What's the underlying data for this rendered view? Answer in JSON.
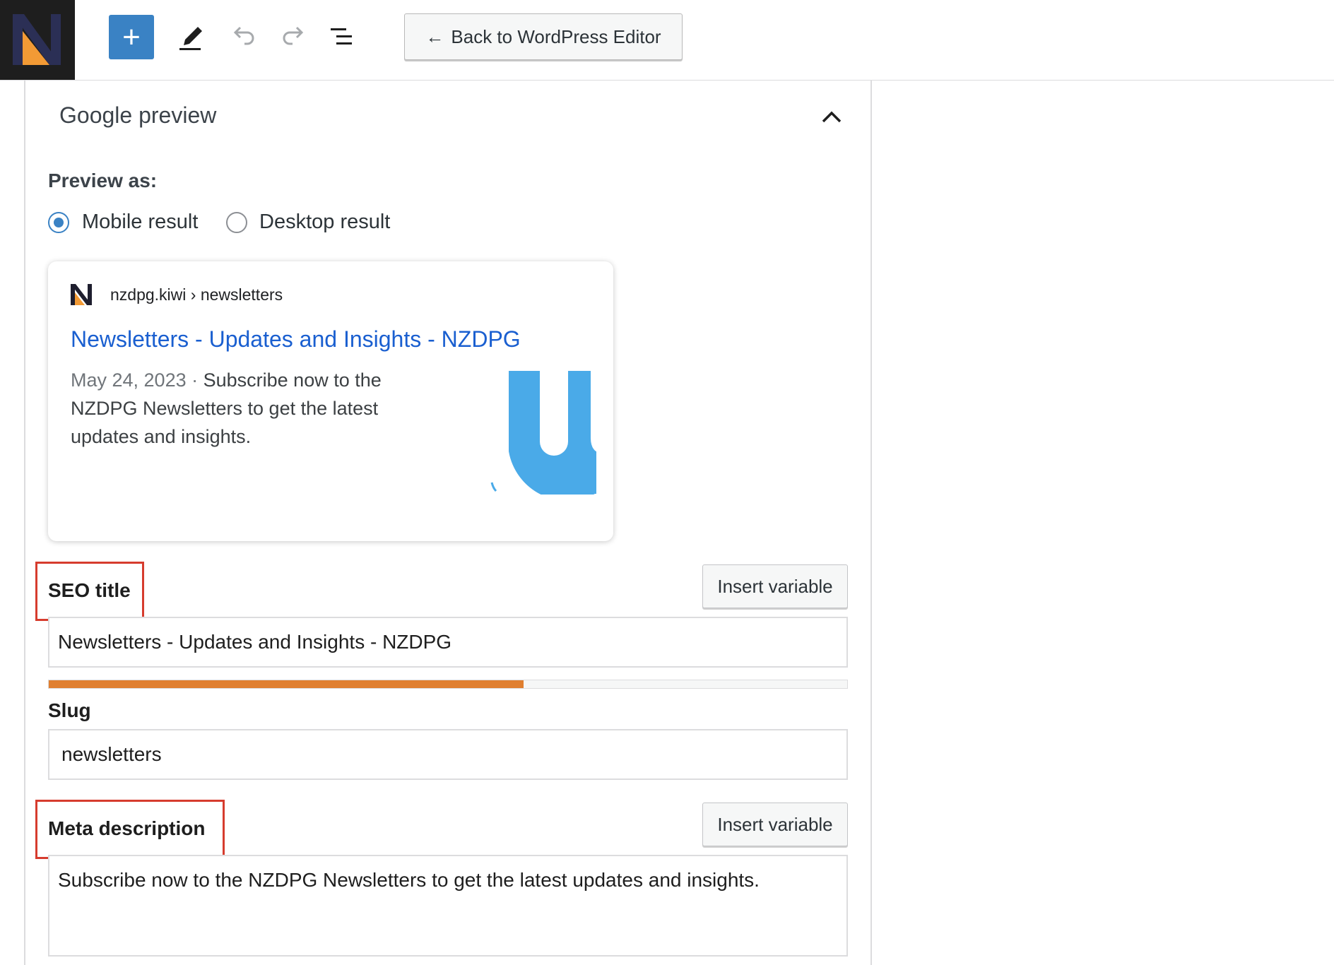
{
  "toolbar": {
    "add_label": "+",
    "back_label": "Back to WordPress Editor",
    "back_arrow": "←",
    "icons": [
      "logo-icon",
      "plus-icon",
      "pencil-icon",
      "undo-icon",
      "redo-icon",
      "document-overview-icon",
      "arrow-left-icon"
    ]
  },
  "google_preview": {
    "section_title": "Google preview",
    "preview_as_label": "Preview as:",
    "options": [
      {
        "label": "Mobile result",
        "checked": true
      },
      {
        "label": "Desktop result",
        "checked": false
      }
    ],
    "card": {
      "breadcrumb": "nzdpg.kiwi › newsletters",
      "title": "Newsletters - Updates and Insights - NZDPG",
      "date": "May 24, 2023",
      "separator": " · ",
      "description": "Subscribe now to the NZDPG Newsletters to get the latest updates and insights.",
      "link_color": "#1a5fd0",
      "thumbnail_color": "#4aaae8"
    }
  },
  "seo_title": {
    "label": "SEO title",
    "insert_button": "Insert variable",
    "value": "Newsletters - Updates and Insights - NZDPG",
    "progress_fraction": 0.595,
    "progress_color": "#e07f30"
  },
  "slug": {
    "label": "Slug",
    "value": "newsletters"
  },
  "meta_description": {
    "label": "Meta description",
    "insert_button": "Insert variable",
    "value": "Subscribe now to the NZDPG Newsletters to get the latest updates and insights."
  },
  "colors": {
    "accent": "#3a82c4",
    "highlight_box": "#d63c2e"
  }
}
